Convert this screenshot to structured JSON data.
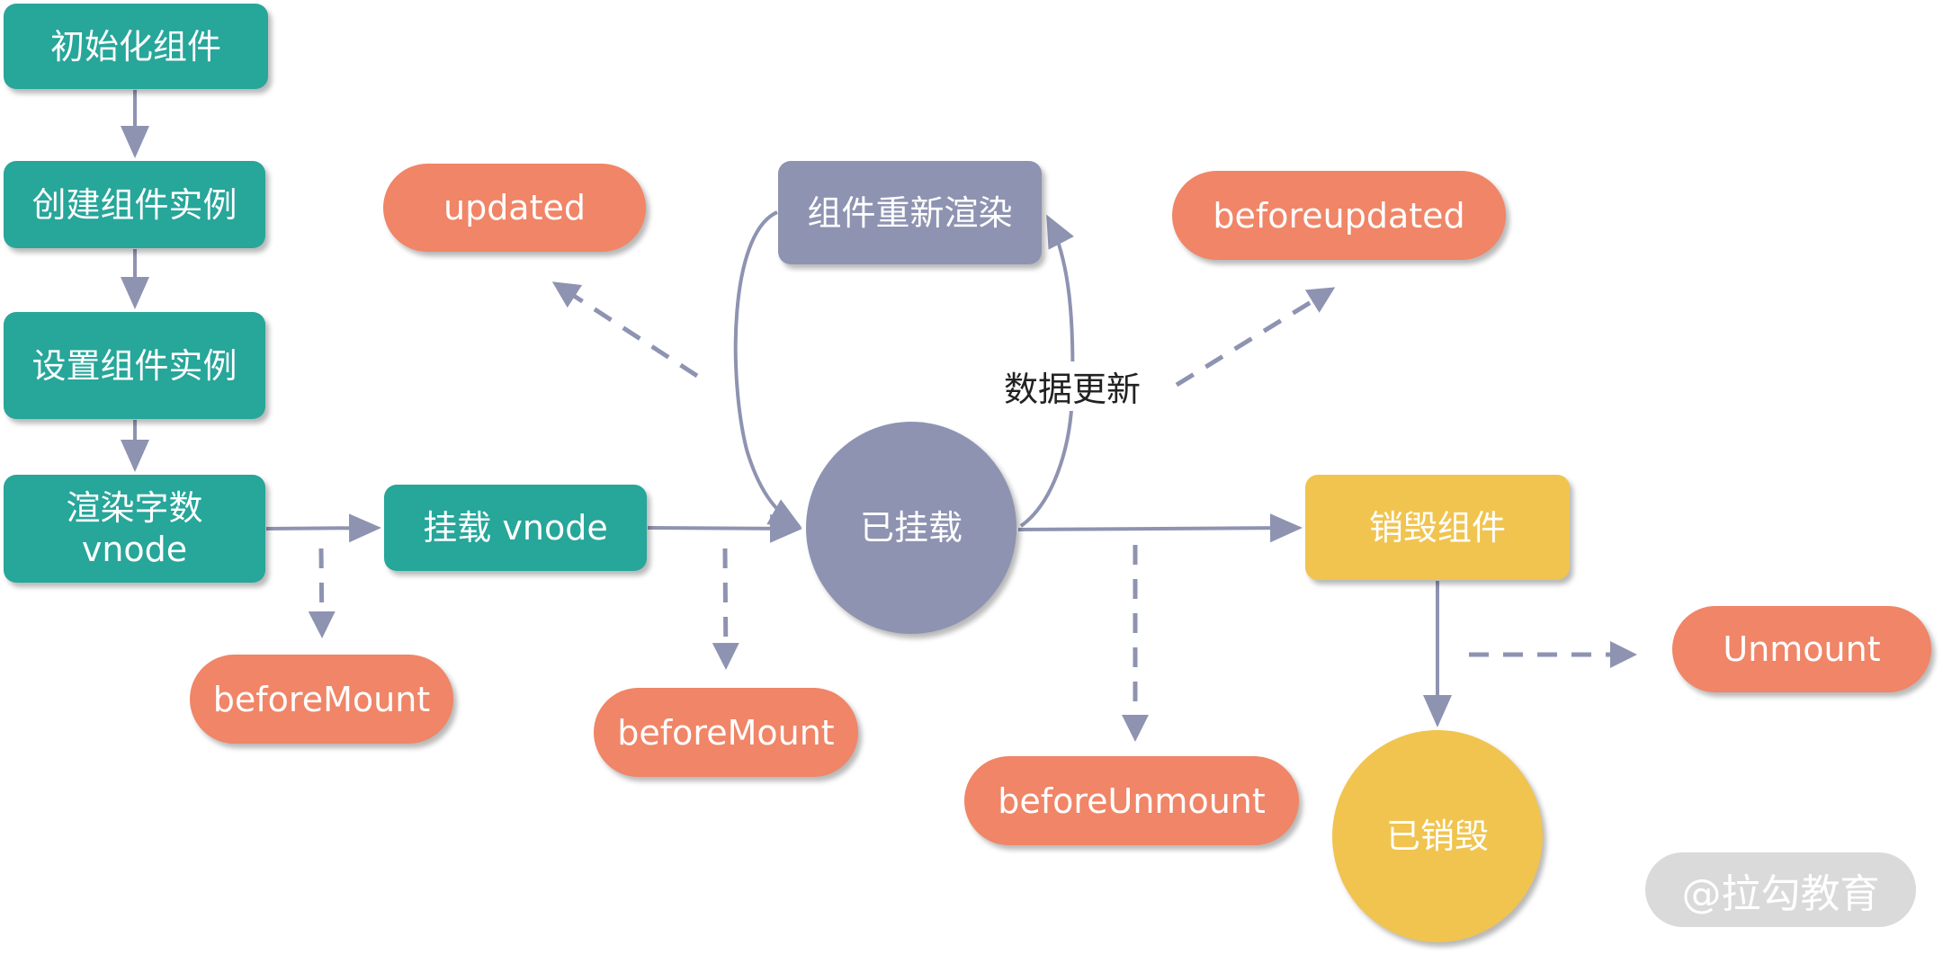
{
  "colors": {
    "init_nodes": "#27a69a",
    "mounted_state": "#8e93b1",
    "destroy_state": "#f0c44f",
    "hooks": "#f08567",
    "arrows": "#8e93b1"
  },
  "nodes": {
    "init_component": "初始化组件",
    "create_instance": "创建组件实例",
    "setup_instance": "设置组件实例",
    "render_vnode_line1": "渲染字数",
    "render_vnode_line2": "vnode",
    "mount_vnode": "挂载 vnode",
    "mounted": "已挂载",
    "rerender": "组件重新渲染",
    "destroy_component": "销毁组件",
    "destroyed": "已销毁"
  },
  "hooks": {
    "updated": "updated",
    "before_updated": "beforeupdated",
    "before_mount_1": "beforeMount",
    "before_mount_2": "beforeMount",
    "before_unmount": "beforeUnmount",
    "unmount": "Unmount"
  },
  "labels": {
    "data_update": "数据更新"
  },
  "watermark": "@拉勾教育"
}
